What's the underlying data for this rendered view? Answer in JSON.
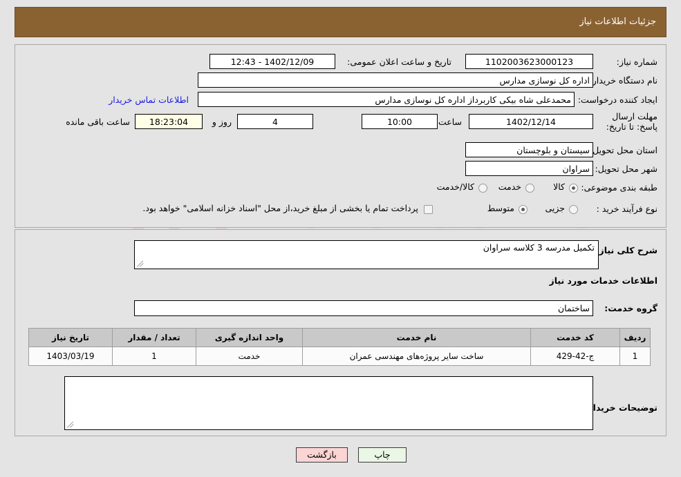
{
  "header": {
    "title": "جزئیات اطلاعات نیاز"
  },
  "form": {
    "need_number_label": "شماره نیاز:",
    "need_number_value": "1102003623000123",
    "public_announce_label": "تاریخ و ساعت اعلان عمومی:",
    "public_announce_value": "1402/12/09 - 12:43",
    "buyer_org_label": "نام دستگاه خریدار:",
    "buyer_org_value": "اداره کل نوسازی مدارس",
    "creator_label": "ایجاد کننده درخواست:",
    "creator_value": "محمدعلی شاه بیکی کاربرداز اداره کل نوسازی مدارس",
    "contact_link": "اطلاعات تماس خریدار",
    "deadline_label": "مهلت ارسال پاسخ: تا تاریخ:",
    "deadline_date": "1402/12/14",
    "hour_label": "ساعت",
    "deadline_time": "10:00",
    "days_value": "4",
    "days_label": "روز و",
    "countdown_value": "18:23:04",
    "remaining_label": "ساعت باقی مانده",
    "province_label": "استان محل تحویل:",
    "province_value": "سیستان و بلوچستان",
    "city_label": "شهر محل تحویل:",
    "city_value": "سراوان",
    "category_label": "طبقه بندی موضوعی:",
    "category_options": [
      {
        "label": "کالا",
        "selected": false
      },
      {
        "label": "خدمت",
        "selected": true
      },
      {
        "label": "کالا/خدمت",
        "selected": false
      }
    ],
    "process_label": "نوع فرآیند خرید :",
    "process_options": [
      {
        "label": "جزیی",
        "selected": false
      },
      {
        "label": "متوسط",
        "selected": true
      }
    ],
    "treasury_checkbox_checked": false,
    "treasury_note": "پرداخت تمام یا بخشی از مبلغ خرید،از محل \"اسناد خزانه اسلامی\" خواهد بود."
  },
  "detail": {
    "general_desc_label": "شرح کلی نیاز:",
    "general_desc_value": "تکمیل مدرسه 3 کلاسه سراوان",
    "services_section_title": "اطلاعات خدمات مورد نیاز",
    "service_group_label": "گروه خدمت:",
    "service_group_value": "ساختمان",
    "buyer_notes_label": "توضیحات خریدار:",
    "buyer_notes_value": ""
  },
  "table": {
    "columns": [
      "ردیف",
      "کد خدمت",
      "نام خدمت",
      "واحد اندازه گیری",
      "تعداد / مقدار",
      "تاریخ نیاز"
    ],
    "rows": [
      {
        "row": "1",
        "code": "ج-42-429",
        "name": "ساخت سایر پروژه‌های مهندسی عمران",
        "unit": "خدمت",
        "qty": "1",
        "date": "1403/03/19"
      }
    ]
  },
  "footer": {
    "print_label": "چاپ",
    "back_label": "بازگشت"
  },
  "watermark": {
    "text": "AnaTender.net"
  },
  "colors": {
    "header_bg": "#8a6232",
    "page_bg": "#e4e4e4",
    "link": "#1a1ae0",
    "print_btn": "#eaf6e6",
    "back_btn": "#fbd4d4",
    "countdown_bg": "#ffffe8"
  }
}
